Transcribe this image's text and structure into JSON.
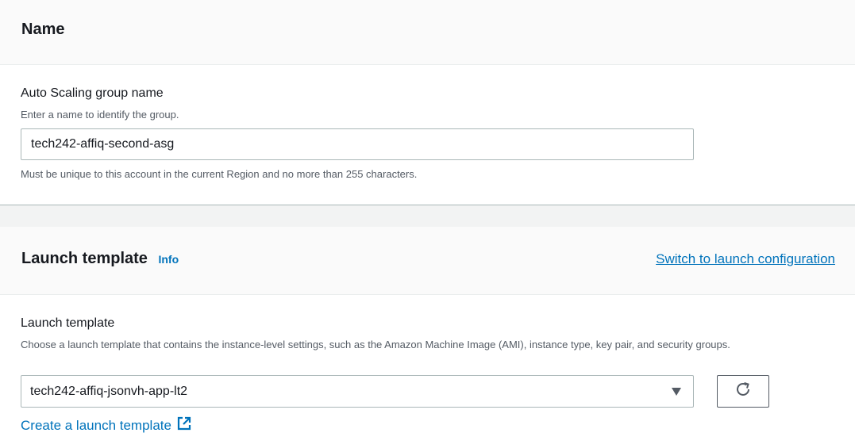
{
  "name_section": {
    "title": "Name",
    "asg_name_label": "Auto Scaling group name",
    "asg_name_description": "Enter a name to identify the group.",
    "asg_name_value": "tech242-affiq-second-asg",
    "asg_name_constraint": "Must be unique to this account in the current Region and no more than 255 characters."
  },
  "launch_template_section": {
    "title": "Launch template",
    "info_link": "Info",
    "switch_link": "Switch to launch configuration",
    "field_label": "Launch template",
    "field_description": "Choose a launch template that contains the instance-level settings, such as the Amazon Machine Image (AMI), instance type, key pair, and security groups.",
    "selected_value": "tech242-affiq-jsonvh-app-lt2",
    "create_link": "Create a launch template"
  },
  "icons": {
    "dropdown": "caret-down-icon",
    "refresh": "refresh-icon",
    "external": "external-link-icon"
  },
  "colors": {
    "link": "#0073bb",
    "text": "#16191f",
    "secondary_text": "#545b64",
    "border": "#aab7b8"
  }
}
